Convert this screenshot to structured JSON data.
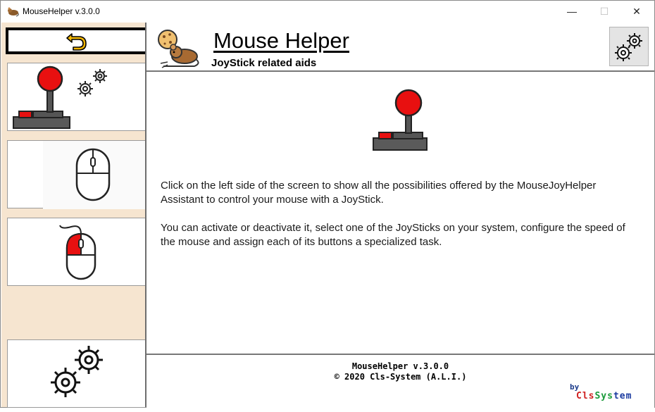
{
  "window": {
    "title": "MouseHelper v.3.0.0",
    "controls": {
      "minimize": "—",
      "maximize": "☐",
      "close": "✕"
    }
  },
  "sidebar": {
    "back_icon": "undo-arrow-icon",
    "items": [
      {
        "name": "joystick-settings",
        "icon": "joystick-gears-icon"
      },
      {
        "name": "mouse",
        "icon": "mouse-icon"
      },
      {
        "name": "mouse-left-click",
        "icon": "mouse-left-button-icon"
      },
      {
        "name": "settings",
        "icon": "gears-icon"
      }
    ]
  },
  "header": {
    "title": "Mouse Helper",
    "subtitle": "JoyStick related aids",
    "logo_icon": "mouse-with-cookie-icon",
    "settings_icon": "gears-icon"
  },
  "content": {
    "icon": "joystick-icon",
    "paragraph1": "Click on the left side of the screen to show all the possibilities offered by the MouseJoyHelper Assistant to control your mouse with a JoyStick.",
    "paragraph2": "You can activate or deactivate it, select one of the JoySticks on your system, configure the speed of the mouse and assign each of its buttons a specialized task."
  },
  "footer": {
    "version": "MouseHelper v.3.0.0",
    "copyright": "©  2020 Cls-System (A.L.I.)",
    "by": "by",
    "brand_part1": "Cls",
    "brand_part2": "Sys",
    "brand_part3": "tem"
  },
  "colors": {
    "sidebar_bg": "#f6e5d0",
    "joystick_red": "#e81010",
    "joystick_base": "#5a5a5a",
    "back_arrow": "#f2b600"
  }
}
